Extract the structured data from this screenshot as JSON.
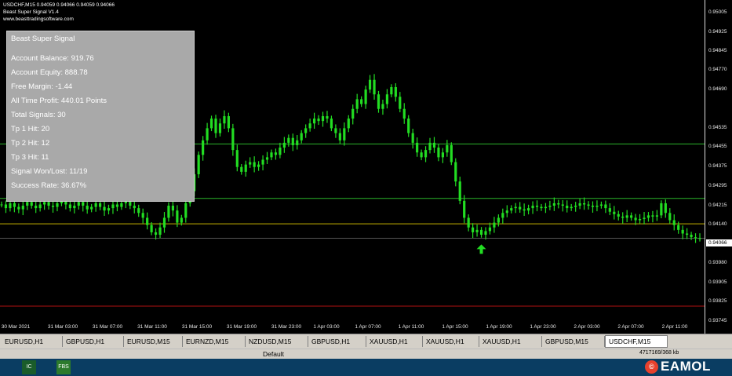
{
  "header": {
    "symbol_line": "USDCHF,M15  0.94059 0.94066 0.94059 0.94066",
    "indicator_name": "Beast Super Signal V1.4",
    "website": "www.beasttradingsoftware.com"
  },
  "panel": {
    "title": "Beast Super Signal",
    "rows": [
      "Account Balance: 919.76",
      "Account Equity: 888.78",
      "Free Margin: -1.44",
      "All Time Profit: 440.01 Points",
      "Total Signals: 30",
      "Tp 1 Hit: 20",
      "Tp 2 Hit: 12",
      "Tp 3 Hit: 11",
      "Signal Won/Lost: 11/19",
      "Success Rate: 36.67%"
    ]
  },
  "price_axis": {
    "labels": [
      "0.95005",
      "0.94925",
      "0.94845",
      "0.94770",
      "0.94690",
      "0.94535",
      "0.94455",
      "0.94375",
      "0.94295",
      "0.94215",
      "0.94140",
      "0.93980",
      "0.93905",
      "0.93825",
      "0.93745"
    ],
    "current_price": "0.94066"
  },
  "time_axis": {
    "labels": [
      "30 Mar 2021",
      "31 Mar 03:00",
      "31 Mar 07:00",
      "31 Mar 11:00",
      "31 Mar 15:00",
      "31 Mar 19:00",
      "31 Mar 23:00",
      "1 Apr 03:00",
      "1 Apr 07:00",
      "1 Apr 11:00",
      "1 Apr 15:00",
      "1 Apr 19:00",
      "1 Apr 23:00",
      "2 Apr 03:00",
      "2 Apr 07:00",
      "2 Apr 11:00"
    ]
  },
  "tabs": {
    "items": [
      "EURUSD,H1",
      "GBPUSD,H1",
      "EURUSD,M15",
      "EURNZD,M15",
      "NZDUSD,M15",
      "GBPUSD,H1",
      "XAUUSD,H1",
      "XAUUSD,H1",
      "XAUUSD,H1",
      "GBPUSD,M15",
      "USDCHF,M15"
    ],
    "active_index": 10
  },
  "status": {
    "profile": "Default",
    "traffic": "4717169/368 kb"
  },
  "taskbar": {
    "icons": [
      "IC",
      "FBS"
    ]
  },
  "watermark": {
    "text": "EAMOL"
  },
  "colors": {
    "candle": "#22dd22",
    "level_green": "#2bb52b",
    "level_yellow": "#c8b400",
    "level_red": "#b01010",
    "panel_bg": "#a9a9a9"
  },
  "chart_data": {
    "type": "candlestick",
    "symbol": "USDCHF",
    "timeframe": "M15",
    "y_range": [
      0.9372,
      0.9505
    ],
    "price_levels": [
      {
        "price": 0.94455,
        "color": "green"
      },
      {
        "price": 0.9423,
        "color": "green"
      },
      {
        "price": 0.94125,
        "color": "yellow"
      },
      {
        "price": 0.94066,
        "color": "current"
      },
      {
        "price": 0.93785,
        "color": "red"
      }
    ],
    "close_path": [
      0.94205,
      0.9419,
      0.9421,
      0.94195,
      0.94185,
      0.942,
      0.94215,
      0.942,
      0.9419,
      0.94205,
      0.94215,
      0.942,
      0.94195,
      0.9421,
      0.9422,
      0.94205,
      0.9419,
      0.942,
      0.94215,
      0.942,
      0.94185,
      0.94195,
      0.9421,
      0.94195,
      0.9418,
      0.9419,
      0.94205,
      0.94195,
      0.9421,
      0.9422,
      0.942,
      0.9419,
      0.9417,
      0.9415,
      0.9412,
      0.9409,
      0.9408,
      0.9411,
      0.9415,
      0.942,
      0.9418,
      0.9413,
      0.9415,
      0.9421,
      0.9426,
      0.9433,
      0.9441,
      0.9447,
      0.9452,
      0.9456,
      0.945,
      0.9454,
      0.9457,
      0.9452,
      0.9443,
      0.9436,
      0.9434,
      0.9437,
      0.9438,
      0.9436,
      0.9437,
      0.9439,
      0.944,
      0.9442,
      0.9441,
      0.9444,
      0.9446,
      0.9448,
      0.9445,
      0.9447,
      0.945,
      0.9452,
      0.9454,
      0.9456,
      0.9455,
      0.9457,
      0.9456,
      0.9452,
      0.945,
      0.9447,
      0.9452,
      0.9456,
      0.946,
      0.9464,
      0.9462,
      0.9468,
      0.9472,
      0.9466,
      0.946,
      0.9462,
      0.9466,
      0.9469,
      0.9465,
      0.946,
      0.9456,
      0.945,
      0.9446,
      0.9442,
      0.944,
      0.9443,
      0.9446,
      0.9444,
      0.944,
      0.9442,
      0.9445,
      0.9438,
      0.943,
      0.9422,
      0.9415,
      0.9411,
      0.9409,
      0.941,
      0.9408,
      0.94095,
      0.9411,
      0.9413,
      0.9415,
      0.9417,
      0.9418,
      0.9419,
      0.94195,
      0.94185,
      0.9418,
      0.9419,
      0.942,
      0.94195,
      0.9419,
      0.94195,
      0.942,
      0.9421,
      0.94205,
      0.942,
      0.9419,
      0.94195,
      0.942,
      0.9421,
      0.94205,
      0.942,
      0.94195,
      0.942,
      0.94205,
      0.9419,
      0.94175,
      0.94165,
      0.94155,
      0.9415,
      0.9416,
      0.9415,
      0.9414,
      0.94145,
      0.9415,
      0.9416,
      0.94155,
      0.9416,
      0.9421,
      0.9417,
      0.9414,
      0.9412,
      0.941,
      0.94085,
      0.9408,
      0.9407,
      0.94066,
      0.94066
    ],
    "signal_arrow": {
      "index": 112,
      "direction": "up",
      "price": 0.9404
    }
  }
}
